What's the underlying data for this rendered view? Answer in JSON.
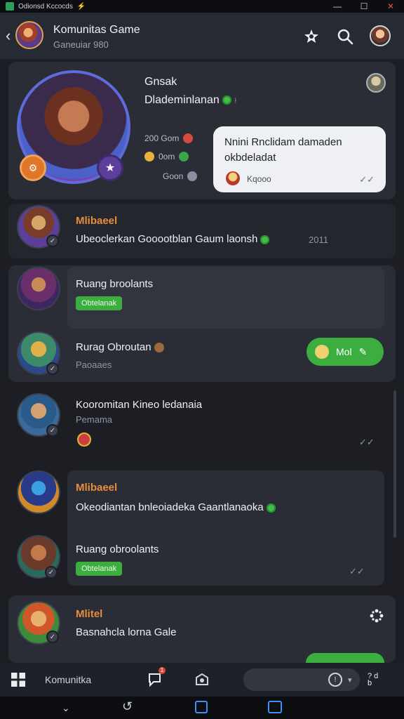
{
  "window": {
    "title": "Odionsd Kccocds",
    "spark": "⚡",
    "minimize": "—",
    "maximize": "☐",
    "close": "✕"
  },
  "header": {
    "back": "‹",
    "title": "Komunitas Game",
    "subtitle": "Ganeuiar 980"
  },
  "profile": {
    "name": "Gnsak",
    "status": "Dlademinlanan",
    "status_suffix": "⟊",
    "stats": [
      {
        "value": "200 Gom",
        "color": "#d9493e"
      },
      {
        "value": "0om",
        "color": "#3aa64a"
      },
      {
        "value": "Goon",
        "color": "#8a8fa0"
      }
    ],
    "bubble": {
      "line1": "Nnini Rnclidam damaden",
      "line2": "okbdeladat",
      "footer": "Kqooo",
      "ticks": "✓✓"
    }
  },
  "feed": [
    {
      "label": "Mlibaeel",
      "text": "Ubeoclerkan Gooootblan Gaum laonsh",
      "time": "2011"
    },
    {
      "title": "Ruang broolants",
      "tag": "Obtelanak"
    },
    {
      "title": "Rurag Obroutan",
      "sub": "Paoaaes",
      "action": "Mol"
    },
    {
      "title": "Kooromitan Kineo ledanaia",
      "sub": "Pemama"
    },
    {
      "label": "Mlibaeel",
      "text": "Okeodiantan bnleoiadeka Gaantlanaoka"
    },
    {
      "title": "Ruang obroolants",
      "tag": "Obtelanak"
    },
    {
      "label": "Mlitel",
      "text": "Basnahcla lorna Gale"
    }
  ],
  "bottombar": {
    "label": "Komunitka",
    "notif": "1",
    "tray": "? d\nb"
  },
  "colors": {
    "accent_green": "#3cae3f",
    "label_orange": "#e88d3a",
    "card": "#2a2d35",
    "background": "#1c1e24"
  },
  "icons": [
    "app-icon",
    "back-icon",
    "achievement-icon",
    "search-icon",
    "settings-icon",
    "grid-icon",
    "chat-icon",
    "game-icon",
    "nav-back-icon",
    "nav-home-icon",
    "nav-recent-icon"
  ]
}
